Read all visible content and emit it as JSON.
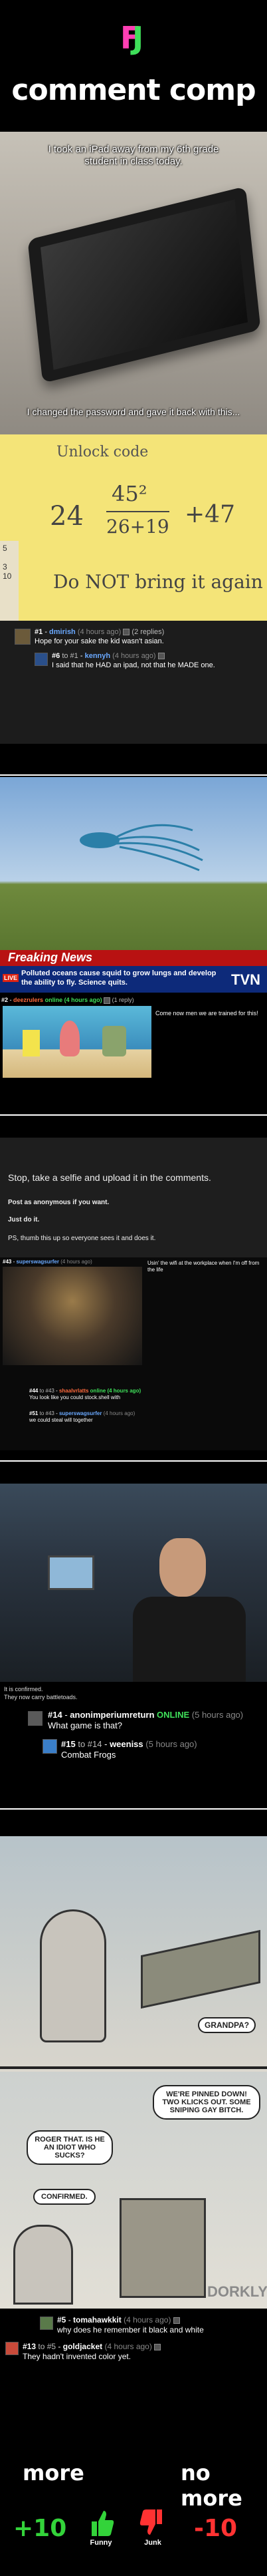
{
  "logo": "FJ",
  "title": "comment comp",
  "panel1": {
    "top_caption": "I took an iPad away from my 6th grade student in class today.",
    "mid_caption": "I changed the password and gave it back with this...",
    "note_title": "Unlock code",
    "note_formula_left": "24",
    "note_formula_num": "45²",
    "note_formula_den": "26+19",
    "note_formula_right": "+47",
    "note_footer": "Do NOT bring it again",
    "c1_num": "#1",
    "c1_user": "dmirish",
    "c1_time": "(4 hours ago)",
    "c1_replies": "(2 replies)",
    "c1_body": "Hope for your sake the kid wasn't asian.",
    "c2_num": "#6",
    "c2_to": "to #1",
    "c2_user": "kennyh",
    "c2_time": "(4 hours ago)",
    "c2_body": "I said that he HAD an ipad, not that he MADE one."
  },
  "panel2": {
    "banner": "Freaking News",
    "live": "LIVE",
    "headline": "Polluted oceans cause squid to grow lungs and develop the ability to fly. Science quits.",
    "network": "TVN",
    "c_num": "#2",
    "c_user": "deezrulers",
    "c_meta": "online (4 hours ago)",
    "c_replies": "(1 reply)",
    "c_body": "Come now men we are trained for this!"
  },
  "panel3": {
    "caption": "Stop, take a selfie and upload it in the comments.",
    "line1": "Post as anonymous if you want.",
    "line2": "Just do it.",
    "line3": "PS, thumb this up so everyone sees it and does it.",
    "c1_num": "#43",
    "c1_user": "superswagsurfer",
    "c1_time": "(4 hours ago)",
    "c1_body": "Usin' the wifi at the workplace when I'm off from the life",
    "c2_num": "#44",
    "c2_to": "to #43",
    "c2_user": "shaalvrlatts",
    "c2_meta": "online (4 hours ago)",
    "c2_body": "You look like you could stock.shell with",
    "c3_num": "#51",
    "c3_to": "to #43",
    "c3_user": "superswagsurfer",
    "c3_time": "(4 hours ago)",
    "c3_body": "we could steal will together"
  },
  "panel4": {
    "caption1": "It is confirmed.",
    "caption2": "They now carry battletoads.",
    "c1_num": "#14",
    "c1_user": "anonimperiumreturn",
    "c1_status": "ONLINE",
    "c1_time": "(5 hours ago)",
    "c1_body": "What game is that?",
    "c2_num": "#15",
    "c2_to": "to #14",
    "c2_user": "weeniss",
    "c2_time": "(5 hours ago)",
    "c2_body": "Combat Frogs"
  },
  "panel5": {
    "bubble_grandpa": "GRANDPA?",
    "bubble1": "WE'RE PINNED DOWN! TWO KLICKS OUT. SOME SNIPING GAY BITCH.",
    "bubble2": "ROGER THAT. IS HE AN IDIOT WHO SUCKS?",
    "bubble3": "CONFIRMED.",
    "watermark": "DORKLY",
    "c1_num": "#5",
    "c1_user": "tomahawkkit",
    "c1_time": "(4 hours ago)",
    "c1_body": "why does he remember it black and white",
    "c2_num": "#13",
    "c2_to": "to #5",
    "c2_user": "goldjacket",
    "c2_time": "(4 hours ago)",
    "c2_body": "They hadn't invented color yet."
  },
  "footer": {
    "more": "more",
    "no_more": "no more",
    "plus": "+10",
    "minus": "-10",
    "funny": "Funny",
    "junk": "Junk"
  },
  "colors": {
    "fj_pink": "#ff3fb4",
    "fj_green": "#3fe05a",
    "plus_green": "#33d33a",
    "minus_red": "#ff3232"
  }
}
